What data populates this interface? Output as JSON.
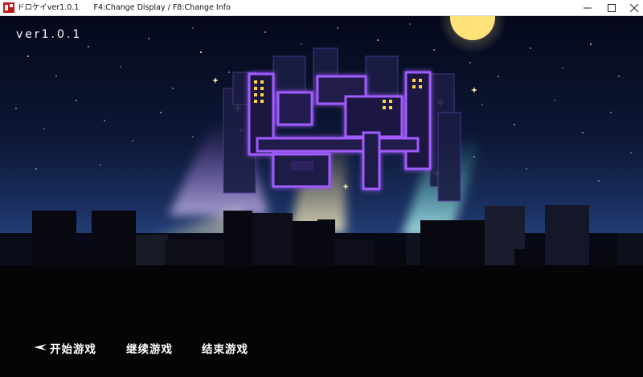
{
  "window": {
    "title": "ドロケイver1.0.1      F4:Change Display / F8:Change Info",
    "icon": "app-icon",
    "controls": [
      "minimize-icon",
      "maximize-icon",
      "close-icon"
    ]
  },
  "game": {
    "version_label": "ver1.0.1",
    "menu": {
      "cursor_icon": "pointer-cursor-icon",
      "items": [
        {
          "label": "开始游戏",
          "selected": true
        },
        {
          "label": "继续游戏",
          "selected": false
        },
        {
          "label": "结束游戏",
          "selected": false
        }
      ]
    }
  },
  "colors": {
    "sky_top": "#070b1f",
    "sky_horizon": "#2e4f8a",
    "logo_neon": "#9b45ff",
    "moon": "#ffe37a"
  }
}
